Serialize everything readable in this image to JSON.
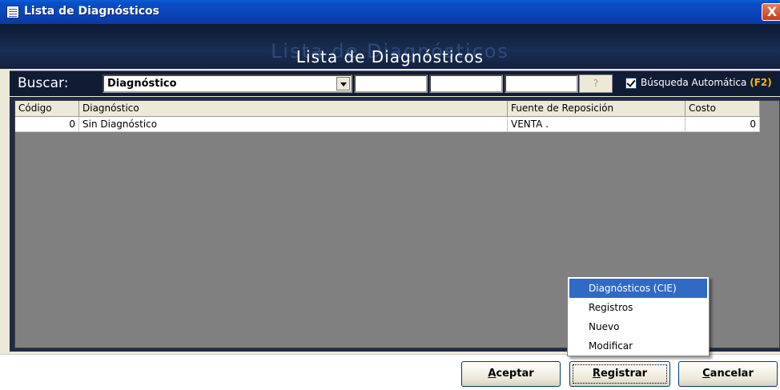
{
  "window": {
    "title": "Lista de Diagnósticos",
    "close_glyph": "X"
  },
  "header": {
    "title": "Lista de Diagnósticos",
    "ghost_text": "Lista de Diagnósticos"
  },
  "search": {
    "label": "Buscar:",
    "field_value": "Diagnóstico",
    "help_button": "?",
    "auto_search_label": "Búsqueda Automática ",
    "auto_search_shortcut": "(F2)",
    "auto_search_checked": true
  },
  "grid": {
    "columns": [
      "Código",
      "Diagnóstico",
      "Fuente de Reposición",
      "Costo"
    ],
    "rows": [
      {
        "codigo": "0",
        "diagnostico": "Sin Diagnóstico",
        "fuente": "VENTA .",
        "costo": "0"
      }
    ]
  },
  "buttons": {
    "accept_first": "A",
    "accept_rest": "ceptar",
    "register_first": "R",
    "register_rest": "egistrar",
    "cancel_first": "C",
    "cancel_rest": "ancelar"
  },
  "menu": {
    "items": [
      "Diagnósticos (CIE)",
      "Registros",
      "Nuevo",
      "Modificar"
    ],
    "selected_index": 0
  },
  "colors": {
    "titlebar": "#0a4ec6",
    "header_bg": "#13223f",
    "selection": "#316ac5",
    "shortcut_accent": "#f6b800"
  }
}
